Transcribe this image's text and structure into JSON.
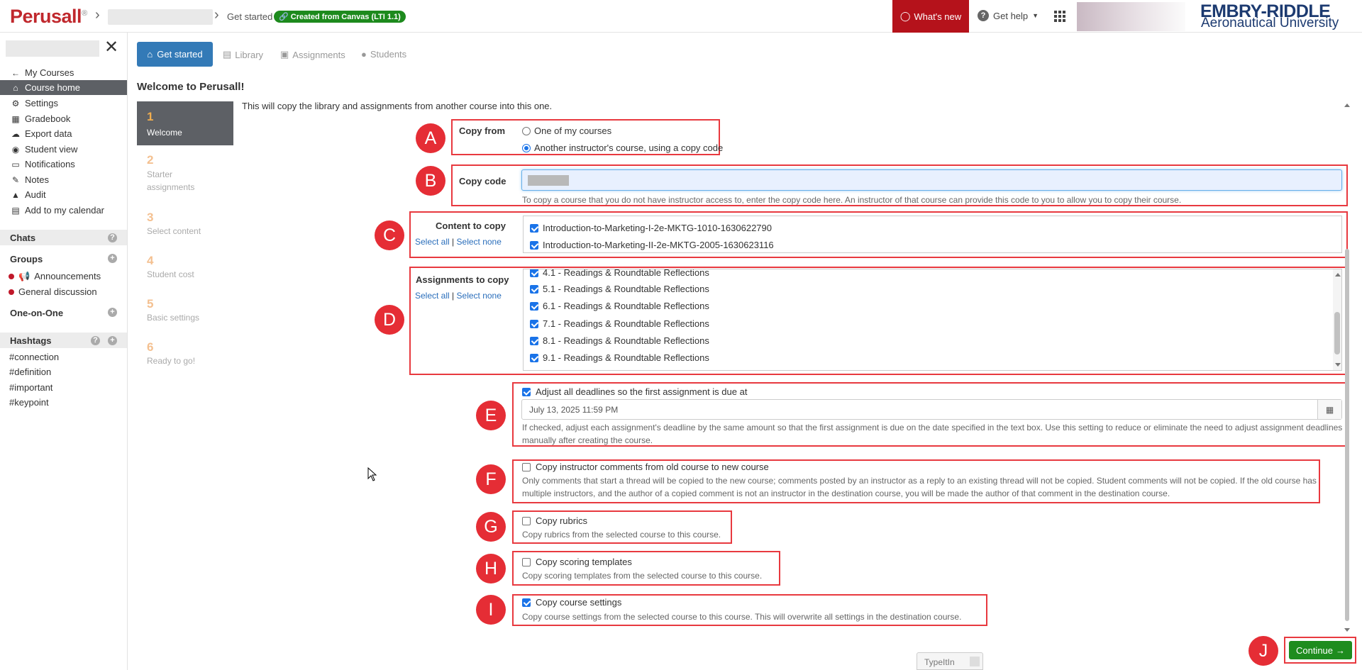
{
  "header": {
    "logo": "Perusall",
    "logo_mark": "®",
    "breadcrumb_current": "Get started",
    "canvas_badge": "Created from Canvas (LTI 1.1)",
    "whats_new": "What's new",
    "get_help": "Get help",
    "university_line1": "EMBRY-RIDDLE",
    "university_line2": "Aeronautical University"
  },
  "sidebar": {
    "nav": [
      {
        "label": "My Courses",
        "icon": "arrow-left-icon"
      },
      {
        "label": "Course home",
        "icon": "home-icon",
        "active": true
      },
      {
        "label": "Settings",
        "icon": "gear-icon"
      },
      {
        "label": "Gradebook",
        "icon": "table-icon"
      },
      {
        "label": "Export data",
        "icon": "cloud-download-icon"
      },
      {
        "label": "Student view",
        "icon": "eye-icon"
      },
      {
        "label": "Notifications",
        "icon": "inbox-icon"
      },
      {
        "label": "Notes",
        "icon": "pencil-icon"
      },
      {
        "label": "Audit",
        "icon": "warning-icon"
      },
      {
        "label": "Add to my calendar",
        "icon": "calendar-icon"
      }
    ],
    "chats": "Chats",
    "groups": "Groups",
    "group_items": [
      "Announcements",
      "General discussion"
    ],
    "one_on_one": "One-on-One",
    "hashtags": "Hashtags",
    "hashtag_items": [
      "#connection",
      "#definition",
      "#important",
      "#keypoint"
    ]
  },
  "tabs": [
    "Get started",
    "Library",
    "Assignments",
    "Students"
  ],
  "page_title": "Welcome to Perusall!",
  "steps": [
    {
      "num": "1",
      "label": "Welcome"
    },
    {
      "num": "2",
      "label": "Starter assignments"
    },
    {
      "num": "3",
      "label": "Select content"
    },
    {
      "num": "4",
      "label": "Student cost"
    },
    {
      "num": "5",
      "label": "Basic settings"
    },
    {
      "num": "6",
      "label": "Ready to go!"
    }
  ],
  "intro": "This will copy the library and assignments from another course into this one.",
  "markers": [
    "A",
    "B",
    "C",
    "D",
    "E",
    "F",
    "G",
    "H",
    "I",
    "J"
  ],
  "copy_from": {
    "label": "Copy from",
    "options": [
      "One of my courses",
      "Another instructor's course, using a copy code"
    ],
    "selected": 1
  },
  "copy_code": {
    "label": "Copy code",
    "help": "To copy a course that you do not have instructor access to, enter the copy code here. An instructor of that course can provide this code to you to allow you to copy their course."
  },
  "content_to_copy": {
    "label": "Content to copy",
    "select_all": "Select all",
    "separator": "|",
    "select_none": "Select none",
    "items": [
      "Introduction-to-Marketing-I-2e-MKTG-1010-1630622790",
      "Introduction-to-Marketing-II-2e-MKTG-2005-1630623116"
    ]
  },
  "assignments_to_copy": {
    "label": "Assignments to copy",
    "select_all": "Select all",
    "separator": "|",
    "select_none": "Select none",
    "items": [
      "4.1 - Readings & Roundtable Reflections",
      "5.1 - Readings & Roundtable Reflections",
      "6.1 - Readings & Roundtable Reflections",
      "7.1 - Readings & Roundtable Reflections",
      "8.1 - Readings & Roundtable Reflections",
      "9.1 - Readings & Roundtable Reflections"
    ]
  },
  "adjust_deadlines": {
    "label": "Adjust all deadlines so the first assignment is due at",
    "checked": true,
    "date_value": "July 13, 2025 11:59 PM",
    "help": "If checked, adjust each assignment's deadline by the same amount so that the first assignment is due on the date specified in the text box. Use this setting to reduce or eliminate the need to adjust assignment deadlines manually after creating the course."
  },
  "copy_comments": {
    "label": "Copy instructor comments from old course to new course",
    "checked": false,
    "help": "Only comments that start a thread will be copied to the new course; comments posted by an instructor as a reply to an existing thread will not be copied. Student comments will not be copied. If the old course has multiple instructors, and the author of a copied comment is not an instructor in the destination course, you will be made the author of that comment in the destination course."
  },
  "copy_rubrics": {
    "label": "Copy rubrics",
    "checked": false,
    "help": "Copy rubrics from the selected course to this course."
  },
  "copy_scoring": {
    "label": "Copy scoring templates",
    "checked": false,
    "help": "Copy scoring templates from the selected course to this course."
  },
  "copy_settings": {
    "label": "Copy course settings",
    "checked": true,
    "help": "Copy course settings from the selected course to this course. This will overwrite all settings in the destination course."
  },
  "continue_button": "Continue",
  "typeit": "TypeItIn",
  "colors": {
    "brand_red": "#c0282d",
    "primary_blue": "#337ab7",
    "success_green": "#1e8c1e",
    "annotation_red": "#e52d35"
  }
}
